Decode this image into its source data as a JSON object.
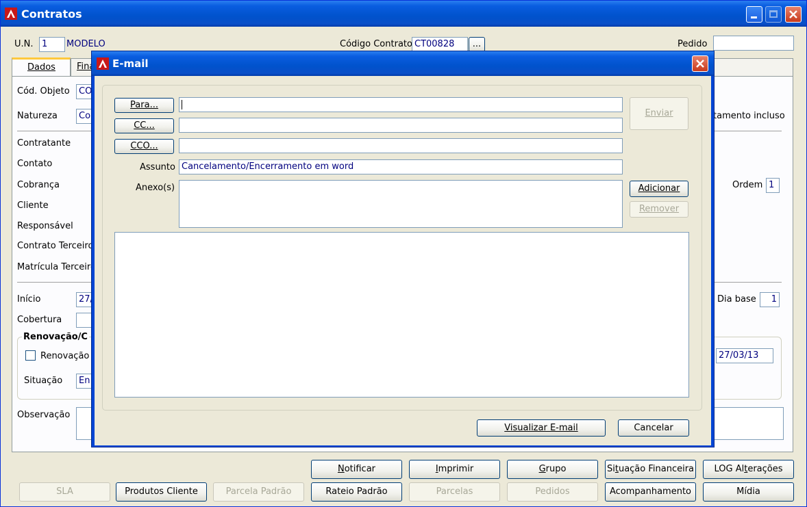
{
  "main": {
    "title": "Contratos",
    "un_label": "U.N.",
    "un_value": "1",
    "un_name": "MODELO",
    "codigo_label": "Código Contrato",
    "codigo_value": "CT00828",
    "browse_label": "...",
    "pedido_label": "Pedido",
    "pedido_value": "",
    "tabs": [
      {
        "label": "Dados"
      },
      {
        "label": "Fina"
      }
    ],
    "cod_objeto_label": "Cód. Objeto",
    "cod_objeto_value": "CO",
    "natureza_label": "Natureza",
    "natureza_value": "Co",
    "orcamento_text": "tamento incluso",
    "contratante_label": "Contratante",
    "contato_label": "Contato",
    "cobranca_label": "Cobrança",
    "cliente_label": "Cliente",
    "responsavel_label": "Responsável",
    "contrato_terceiro_label": "Contrato Terceiro",
    "matricula_terceiro_label": "Matrícula Terceiro",
    "ordem_label": "Ordem",
    "ordem_value": "1",
    "inicio_label": "Início",
    "inicio_value": "27/",
    "cobertura_label": "Cobertura",
    "dia_base_label": "Dia base",
    "dia_base_value": "1",
    "renovacao_group_label": "Renovação/C",
    "renovacao_checkbox_label": "Renovação",
    "renovacao_date": "27/03/13",
    "situacao_label": "Situação",
    "situacao_value": "En",
    "observacao_label": "Observação",
    "buttons_row1": [
      {
        "label": "Notificar",
        "u": "N",
        "rest": "otificar"
      },
      {
        "label": "Imprimir",
        "u": "I",
        "rest": "mprimir"
      },
      {
        "label": "Grupo",
        "u": "G",
        "rest": "rupo"
      },
      {
        "label": "Situação Financeira",
        "pre": "Si",
        "u": "t",
        "rest": "uação Financeira"
      },
      {
        "label": "LOG Alterações",
        "pre": "LOG Al",
        "u": "t",
        "rest": "erações"
      }
    ],
    "buttons_row2": [
      {
        "label": "SLA"
      },
      {
        "label": "Produtos Cliente"
      },
      {
        "label": "Parcela Padrão"
      },
      {
        "label": "Rateio Padrão"
      },
      {
        "label": "Parcelas"
      },
      {
        "label": "Pedidos"
      },
      {
        "label": "Acompanhamento"
      },
      {
        "label": "Mídia"
      }
    ]
  },
  "email": {
    "title": "E-mail",
    "para_label": "Para...",
    "cc_label": "CC...",
    "cco_label": "CCO...",
    "para_value": "",
    "cc_value": "",
    "cco_value": "",
    "assunto_label": "Assunto",
    "assunto_value": "Cancelamento/Encerramento em word",
    "anexos_label": "Anexo(s)",
    "enviar_label": "Enviar",
    "adicionar_label": "Adicionar",
    "remover_label": "Remover",
    "visualizar_label": "Visualizar E-mail",
    "cancelar_label": "Cancelar"
  }
}
